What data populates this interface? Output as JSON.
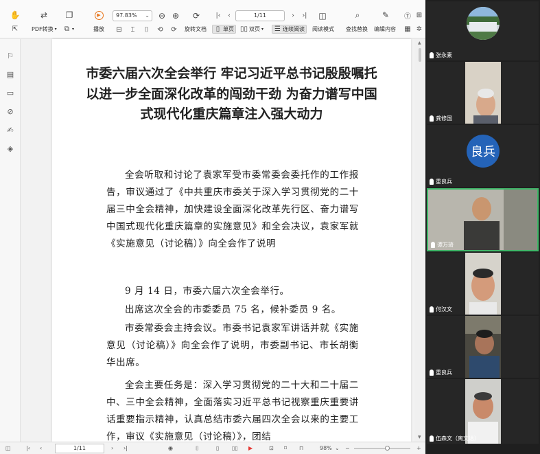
{
  "toolbar": {
    "pdf_convert": "PDF转换",
    "play": "播放",
    "zoom": "97.83%",
    "page_indicator": "1/11",
    "rotate": "旋转文档",
    "single_page": "单页",
    "double_page": "双页",
    "continuous": "连续阅读",
    "read_mode": "阅读模式",
    "find_replace": "查找替换",
    "edit_content": "编辑内容"
  },
  "document": {
    "title": "市委六届六次全会举行 牢记习近平总书记殷殷嘱托 以进一步全面深化改革的闯劲干劲 为奋力谱写中国式现代化重庆篇章注入强大动力",
    "paragraphs": [
      "全会听取和讨论了袁家军受市委常委会委托作的工作报告，审议通过了《中共重庆市委关于深入学习贯彻党的二十届三中全会精神，加快建设全面深化改革先行区、奋力谱写中国式现代化重庆篇章的实施意见》和全会决议，袁家军就《实施意见（讨论稿）》向全会作了说明",
      "9 月 14 日，市委六届六次全会举行。",
      "出席这次全会的市委委员 75 名，候补委员 9 名。",
      "市委常委会主持会议。市委书记袁家军讲话并就《实施意见（讨论稿）》向全会作了说明，市委副书记、市长胡衡华出席。",
      "全会主要任务是：深入学习贯彻党的二十大和二十届二中、三中全会精神，全面落实习近平总书记视察重庆重要讲话重要指示精神，认真总结市委六届四次全会以来的主要工作，审议《实施意见（讨论稿）》，团结"
    ]
  },
  "statusbar": {
    "page_indicator": "1/11",
    "zoom": "98%"
  },
  "participants": [
    {
      "name": "张永素",
      "type": "video"
    },
    {
      "name": "龚修国",
      "type": "video"
    },
    {
      "name": "重良兵",
      "type": "avatar",
      "avatar_text": "良兵",
      "avatar_color": "#2463b8"
    },
    {
      "name": "谭万琦",
      "type": "video",
      "active": true
    },
    {
      "name": "何汉文",
      "type": "video"
    },
    {
      "name": "重良兵",
      "type": "video"
    },
    {
      "name": "伍森文（离文达）",
      "type": "video"
    }
  ],
  "colors": {
    "active_border": "#3fb668",
    "accent": "#e8751a"
  }
}
